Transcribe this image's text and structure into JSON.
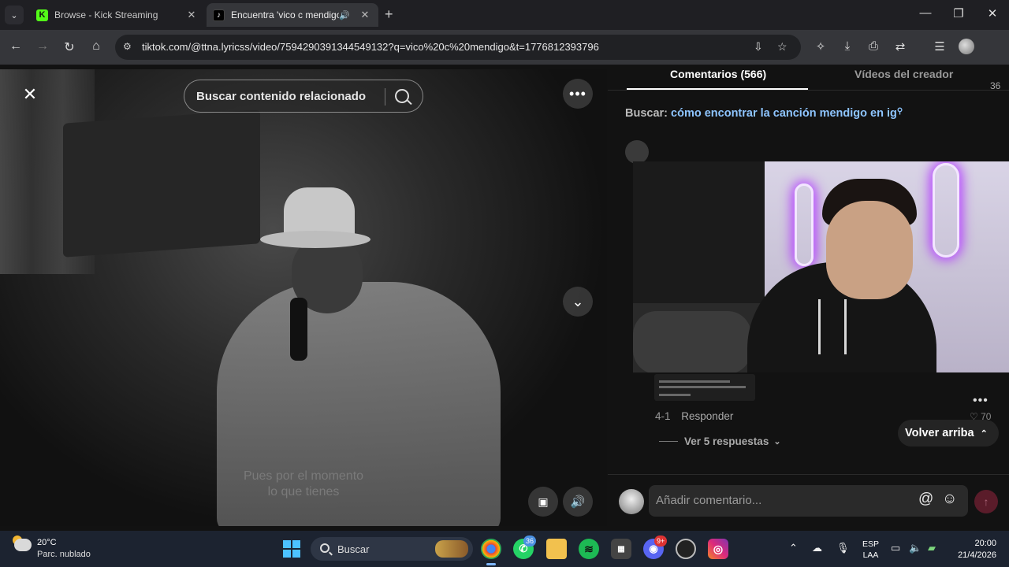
{
  "browser": {
    "tabs": [
      {
        "title": "Browse - Kick Streaming",
        "favicon": "K",
        "active": false
      },
      {
        "title": "Encuentra 'vico c mendigo' ",
        "favicon": "♪",
        "active": true
      }
    ],
    "url": "tiktok.com/@ttna.lyricss/video/7594290391344549132?q=vico%20c%20mendigo&t=1776812393796"
  },
  "video": {
    "search_placeholder": "Buscar contenido relacionado",
    "lyrics_line1": "Pues por el momento",
    "lyrics_line2": "lo que tienes"
  },
  "panel": {
    "tab_comments": "Comentarios (566)",
    "tab_creator_videos": "Vídeos del creador",
    "tab_count": "36",
    "search_label": "Buscar:",
    "search_query": "cómo encontrar la canción mendigo en ig",
    "comment": {
      "date": "4-1",
      "reply_label": "Responder",
      "like_count": "70",
      "view_replies": "Ver 5 respuestas"
    },
    "back_to_top": "Volver arriba",
    "composer_placeholder": "Añadir comentario..."
  },
  "taskbar": {
    "weather_temp": "20°C",
    "weather_desc": "Parc. nublado",
    "search_placeholder": "Buscar",
    "whatsapp_badge": "36",
    "discord_badge": "9+",
    "lang_line1": "ESP",
    "lang_line2": "LAA",
    "time": "20:00",
    "date": "21/4/2026"
  },
  "colors": {
    "accent_link": "#8ec5ff",
    "send_button": "#5a1c2a",
    "kick_green": "#53fc18",
    "windows_blue": "#4cc2ff"
  }
}
